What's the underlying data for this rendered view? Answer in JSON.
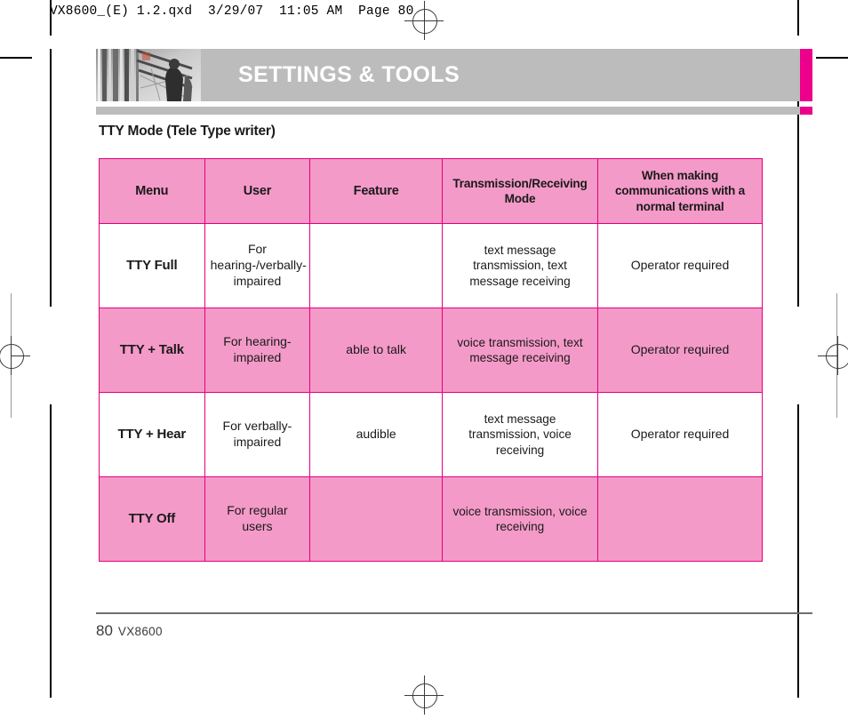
{
  "prepress": {
    "slug": "VX8600_(E) 1.2.qxd  3/29/07  11:05 AM  Page 80"
  },
  "header": {
    "title": "SETTINGS & TOOLS",
    "photo_alt": "abstract-architecture-photo",
    "banner_color": "#bcbcbc",
    "accent_color": "#ec008c"
  },
  "section": {
    "title": "TTY Mode (Tele Type writer)"
  },
  "table": {
    "border_color": "#e5007e",
    "header_fill": "#f49ac8",
    "row_fill": "#f49ac8",
    "headers": [
      "Menu",
      "User",
      "Feature",
      "Transmission/Receiving Mode",
      "When making communications with a normal terminal"
    ],
    "rows": [
      {
        "shade": "white",
        "menu": "TTY Full",
        "user": "For hearing-/verbally-impaired",
        "feature": "",
        "mode": "text message transmission, text message receiving",
        "note": "Operator required"
      },
      {
        "shade": "pink",
        "menu": "TTY + Talk",
        "user": "For hearing-impaired",
        "feature": "able to talk",
        "mode": "voice transmission, text message receiving",
        "note": "Operator required"
      },
      {
        "shade": "white",
        "menu": "TTY + Hear",
        "user": "For verbally-impaired",
        "feature": "audible",
        "mode": "text message transmission, voice receiving",
        "note": "Operator required"
      },
      {
        "shade": "pink",
        "menu": "TTY Off",
        "user": "For regular users",
        "feature": "",
        "mode": "voice transmission, voice receiving",
        "note": ""
      }
    ]
  },
  "footer": {
    "page_number": "80",
    "model": "VX8600"
  }
}
